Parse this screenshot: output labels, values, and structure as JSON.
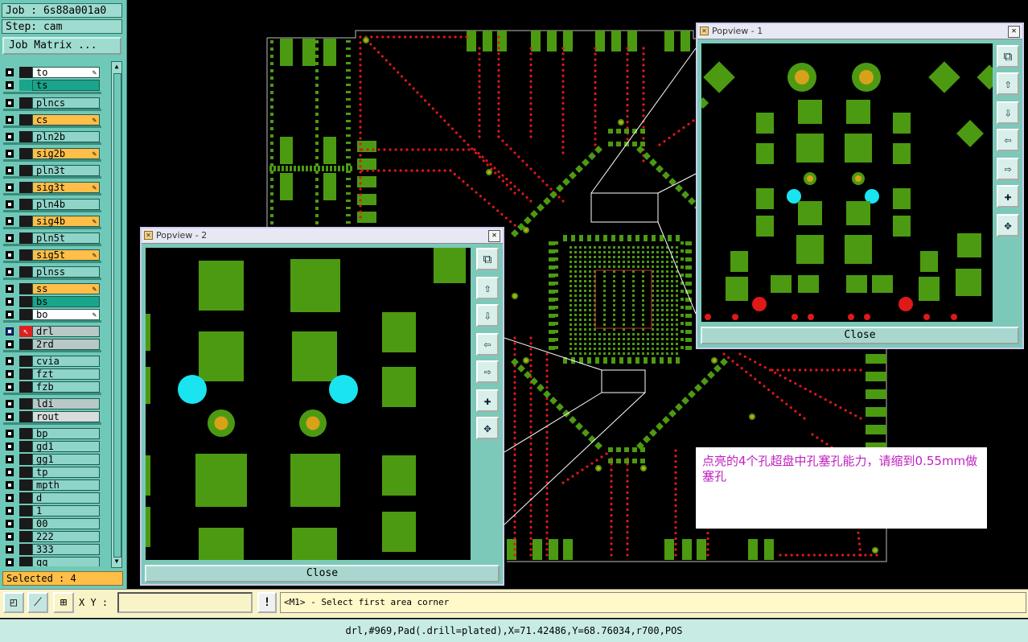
{
  "left_panel": {
    "job_label": "Job : 6s88a001a0",
    "step_label": "Step: cam",
    "job_matrix_button": "Job Matrix ...",
    "layers": [
      {
        "name": "to",
        "style": "white",
        "editable": true
      },
      {
        "name": "ts",
        "style": "green",
        "editable": false
      },
      {
        "name": "plncs",
        "style": "teal",
        "editable": false
      },
      {
        "name": "cs",
        "style": "orange",
        "editable": true
      },
      {
        "name": "pln2b",
        "style": "teal",
        "editable": false
      },
      {
        "name": "sig2b",
        "style": "orange",
        "editable": true
      },
      {
        "name": "pln3t",
        "style": "teal",
        "editable": false
      },
      {
        "name": "sig3t",
        "style": "orange",
        "editable": true
      },
      {
        "name": "pln4b",
        "style": "teal",
        "editable": false
      },
      {
        "name": "sig4b",
        "style": "orange",
        "editable": true
      },
      {
        "name": "pln5t",
        "style": "teal",
        "editable": false
      },
      {
        "name": "sig5t",
        "style": "orange",
        "editable": true
      },
      {
        "name": "plnss",
        "style": "teal",
        "editable": false
      },
      {
        "name": "ss",
        "style": "orange",
        "editable": true
      },
      {
        "name": "bs",
        "style": "green",
        "editable": false
      },
      {
        "name": "bo",
        "style": "white",
        "editable": true
      },
      {
        "name": "drl",
        "style": "gray",
        "editable": false,
        "active": true
      },
      {
        "name": "2rd",
        "style": "gray",
        "editable": false
      },
      {
        "name": "cvia",
        "style": "teal",
        "editable": false
      },
      {
        "name": "fzt",
        "style": "teal",
        "editable": false
      },
      {
        "name": "fzb",
        "style": "teal",
        "editable": false
      },
      {
        "name": "ldi",
        "style": "gray",
        "editable": false
      },
      {
        "name": "rout",
        "style": "lgray",
        "editable": false
      },
      {
        "name": "bp",
        "style": "teal",
        "editable": false
      },
      {
        "name": "gd1",
        "style": "teal",
        "editable": false
      },
      {
        "name": "gg1",
        "style": "teal",
        "editable": false
      },
      {
        "name": "tp",
        "style": "teal",
        "editable": false
      },
      {
        "name": "mpth",
        "style": "teal",
        "editable": false
      },
      {
        "name": "d",
        "style": "teal",
        "editable": false
      },
      {
        "name": "1",
        "style": "teal",
        "editable": false
      },
      {
        "name": "00",
        "style": "teal",
        "editable": false
      },
      {
        "name": "222",
        "style": "teal",
        "editable": false
      },
      {
        "name": "333",
        "style": "teal",
        "editable": false
      },
      {
        "name": "qq",
        "style": "teal",
        "editable": false
      }
    ],
    "selected_label": "Selected : 4"
  },
  "popview1": {
    "title": "Popview - 1",
    "close_label": "Close"
  },
  "popview2": {
    "title": "Popview - 2",
    "close_label": "Close"
  },
  "note": {
    "text": " 点亮的4个孔超盘中孔塞孔能力，请缩到0.55mm做塞孔"
  },
  "bottom": {
    "xy_label": "X Y :",
    "xy_value": "",
    "message_button": "!",
    "prompt": "<M1> - Select first area corner",
    "status": "drl,#969,Pad(.drill=plated),X=71.42486,Y=68.76034,r700,POS"
  },
  "colors": {
    "pad_green": "#4c9a12",
    "drill_red": "#e01818",
    "highlight_cyan": "#19e4f0",
    "via_ring": "#d7a21a",
    "panel_teal": "#6fc9b8"
  }
}
